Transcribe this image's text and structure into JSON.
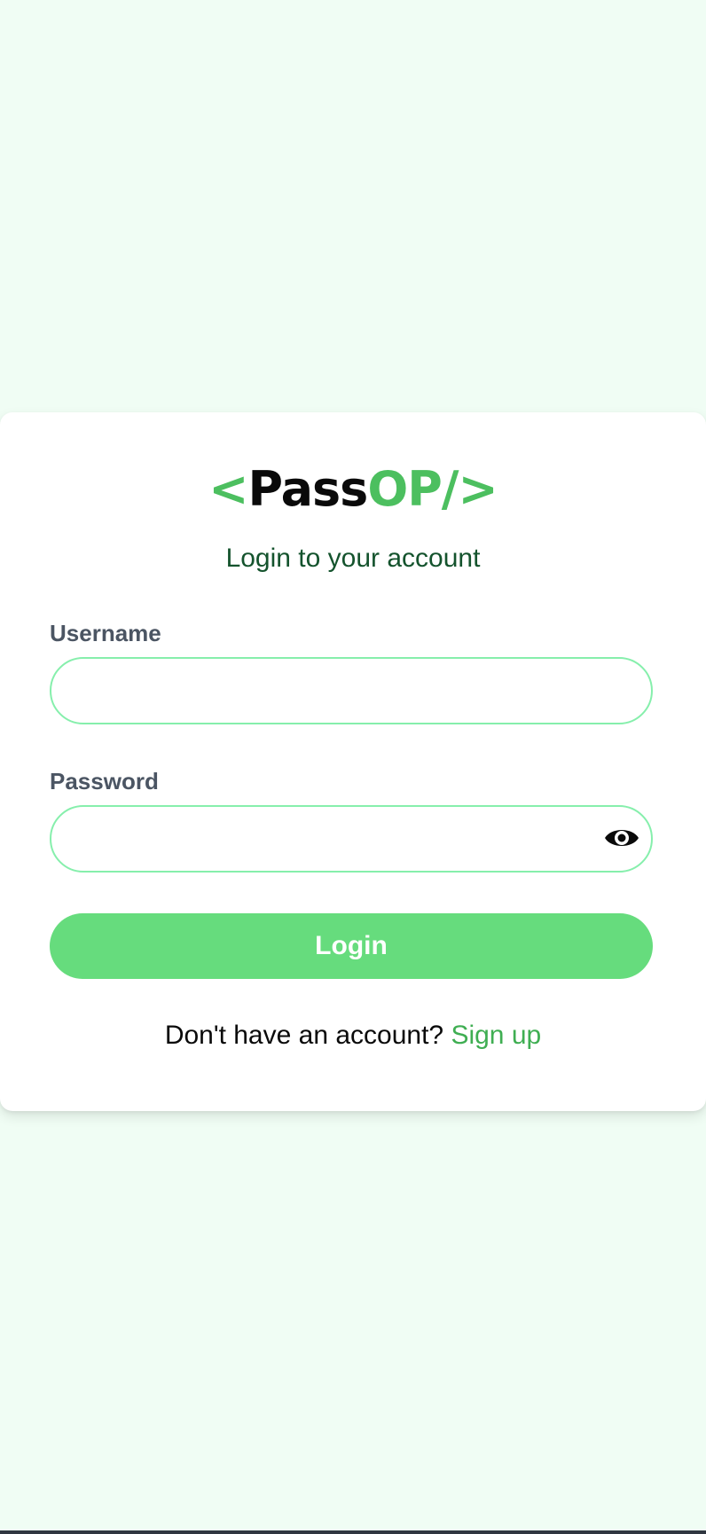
{
  "logo": {
    "open_bracket": "<",
    "pass": "Pass",
    "op": "OP/>"
  },
  "subtitle": "Login to your account",
  "form": {
    "username_label": "Username",
    "username_value": "",
    "password_label": "Password",
    "password_value": "",
    "show_password_icon": "eye-icon",
    "login_label": "Login"
  },
  "footer": {
    "prompt": "Don't have an account? ",
    "signup_link": "Sign up"
  },
  "colors": {
    "background": "#f0fdf4",
    "accent": "#4cbf5f",
    "button": "#66dc7d",
    "field_border": "#86efac",
    "subtitle": "#14532d"
  }
}
